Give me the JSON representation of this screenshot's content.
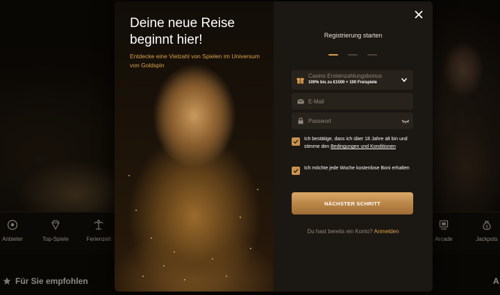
{
  "background": {
    "categories": [
      {
        "label": "Anbieter",
        "icon": "soccer-ball-icon"
      },
      {
        "label": "Top-Spiele",
        "icon": "diamond-icon"
      },
      {
        "label": "Ferienzeit",
        "icon": "palm-tree-icon"
      },
      {
        "label": "Arcade",
        "icon": "arcade-screen-icon"
      },
      {
        "label": "Jackpots",
        "icon": "coin-bag-icon"
      }
    ],
    "recommended_title": "Für Sie empfohlen",
    "right_heading_partial": "A"
  },
  "modal": {
    "hero": {
      "title": "Deine neue Reise beginnt hier!",
      "subtitle": "Entdecke eine Vielzahl von Spielen im Universum von Goldspin"
    },
    "registration_title": "Registrierung starten",
    "steps_total": 3,
    "steps_active": 1,
    "bonus": {
      "name": "Casino Ersteinzahlungsbonus",
      "description": "100% bis zu €1500 + 100 Freispiele"
    },
    "email": {
      "placeholder": "E-Mail",
      "value": ""
    },
    "password": {
      "placeholder": "Passwort",
      "value": ""
    },
    "consent_age": {
      "checked": true,
      "text_before": "Ich bestätige, dass ich über 18 Jahre alt bin und stimme den",
      "link_text": "Bedingungen und Konditionen",
      "text_after": "zu"
    },
    "consent_newsletter": {
      "checked": true,
      "text": "Ich möchte jede Woche kostenlose Boni erhalten"
    },
    "next_button": "NÄCHSTER SCHRITT",
    "login_prompt": "Du hast bereits ein Konto?",
    "login_link": "Anmelden"
  },
  "colors": {
    "accent": "#d9a24e",
    "button_gold": "#c99350",
    "panel": "#1b1712",
    "field": "#27221b"
  }
}
